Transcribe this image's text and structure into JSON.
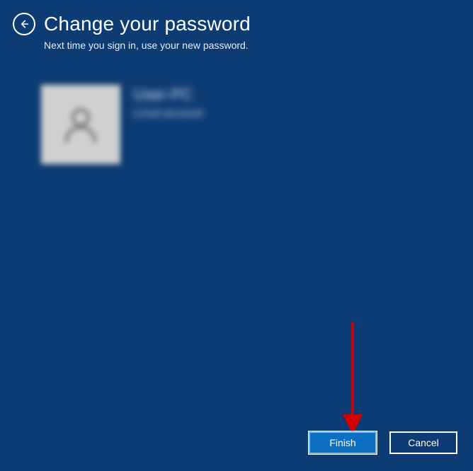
{
  "header": {
    "title": "Change your password",
    "subtitle": "Next time you sign in, use your new password."
  },
  "account": {
    "name": "User-PC",
    "type": "Local account"
  },
  "buttons": {
    "finish": "Finish",
    "cancel": "Cancel"
  },
  "annotation": {
    "arrow_target": "finish-button"
  }
}
